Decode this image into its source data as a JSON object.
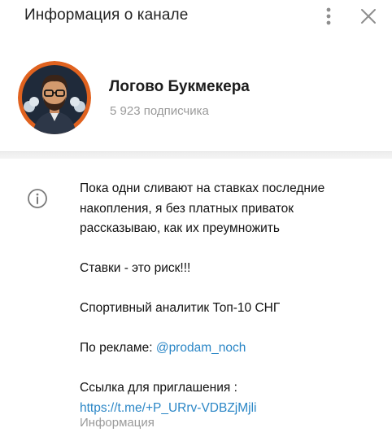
{
  "header": {
    "title": "Информация о канале",
    "menu_icon": "more-vertical-icon",
    "close_icon": "close-icon"
  },
  "profile": {
    "name": "Логово Букмекера",
    "subscribers": "5 923 подписчика",
    "avatar_accent": "#e0621f"
  },
  "description": {
    "icon": "info-icon",
    "intro": "Пока одни сливают на ставках последние накопления, я без платных приваток рассказываю, как их преумножить",
    "warning": "Ставки - это риск!!!",
    "analyst": "Спортивный аналитик Топ-10 СНГ",
    "ads_label": "По рекламе: ",
    "ads_handle": "@prodam_noch",
    "invite_label": "Ссылка для приглашения :",
    "invite_link": "https://t.me/+P_URrv-VDBZjMjli",
    "caption": "Информация"
  },
  "colors": {
    "link": "#2a86c6",
    "secondary_text": "#9a9a9a"
  }
}
